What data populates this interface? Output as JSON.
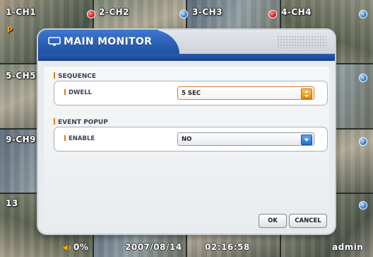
{
  "channels": [
    {
      "label": "1-CH1",
      "rec": false
    },
    {
      "label": "2-CH2",
      "rec": true
    },
    {
      "label": "3-CH3",
      "rec": false
    },
    {
      "label": "4-CH4",
      "rec": true
    },
    {
      "label": "5-CH5"
    },
    {
      "label": "9-CH9"
    },
    {
      "label": "13"
    }
  ],
  "ptz_mark": "P",
  "status": {
    "volume": "0%",
    "date": "2007/08/14",
    "time": "02:16:58",
    "user": "admin"
  },
  "dialog": {
    "title": "MAIN MONITOR",
    "sequence": {
      "section_label": "SEQUENCE",
      "dwell_label": "DWELL",
      "dwell_value": "5 SEC"
    },
    "event_popup": {
      "section_label": "EVENT POPUP",
      "enable_label": "ENABLE",
      "enable_value": "NO"
    },
    "ok_label": "OK",
    "cancel_label": "CANCEL"
  },
  "colors": {
    "header_blue": "#1f4fa2",
    "accent_orange": "#e07a10",
    "rec_red": "#d71c1c",
    "indicator_blue": "#2e7fd8"
  }
}
